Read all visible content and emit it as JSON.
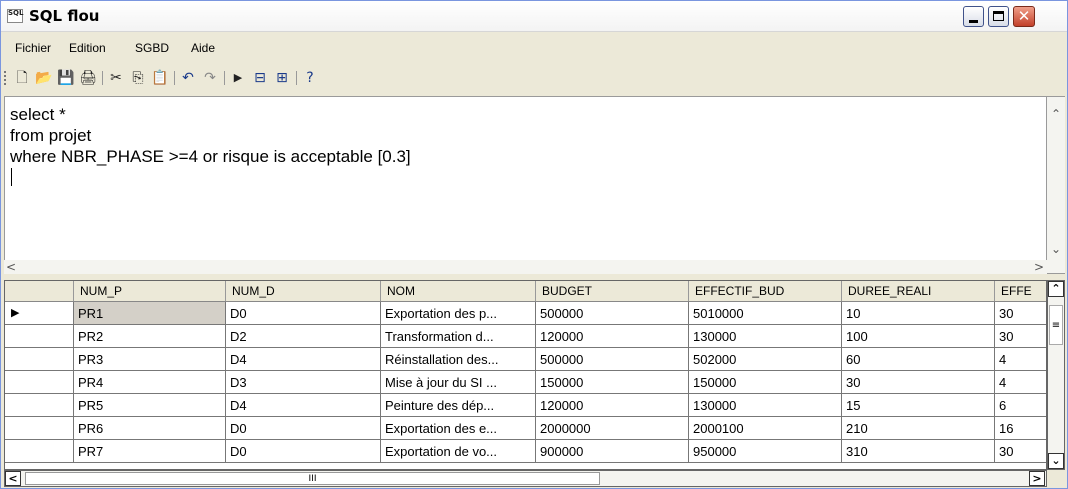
{
  "window": {
    "title": "SQL flou",
    "icon_text": "SQL",
    "icon": "sql-app-icon"
  },
  "menu": [
    "Fichier",
    "Edition",
    "SGBD",
    "Aide"
  ],
  "toolbar": {
    "icons": [
      "new-icon",
      "open-icon",
      "save-icon",
      "print-icon",
      "cut-icon",
      "copy-icon",
      "paste-icon",
      "undo-icon",
      "redo-icon",
      "run-icon",
      "import-icon",
      "export-icon",
      "help-icon"
    ]
  },
  "editor": {
    "lines": [
      "select *",
      "from projet",
      "where NBR_PHASE >=4 or risque is acceptable [0.3]"
    ]
  },
  "grid": {
    "columns": [
      "NUM_P",
      "NUM_D",
      "NOM",
      "BUDGET",
      "EFFECTIF_BUD",
      "DUREE_REALI",
      "EFFE"
    ],
    "rows": [
      [
        "PR1",
        "D0",
        "Exportation des p...",
        "500000",
        "5010000",
        "10",
        "30"
      ],
      [
        "PR2",
        "D2",
        "Transformation d...",
        "120000",
        "130000",
        "100",
        "30"
      ],
      [
        "PR3",
        "D4",
        "Réinstallation des...",
        "500000",
        "502000",
        "60",
        "4"
      ],
      [
        "PR4",
        "D3",
        "Mise à jour du SI ...",
        "150000",
        "150000",
        "30",
        "4"
      ],
      [
        "PR5",
        "D4",
        "Peinture des dép...",
        "120000",
        "130000",
        "15",
        "6"
      ],
      [
        "PR6",
        "D0",
        "Exportation des e...",
        "2000000",
        "2000100",
        "210",
        "16"
      ],
      [
        "PR7",
        "D0",
        "Exportation de vo...",
        "900000",
        "950000",
        "310",
        "30"
      ]
    ],
    "current_row_marker": "▶"
  },
  "scroll": {
    "thumb_glyph": "III",
    "vthumb_glyph": "≡"
  }
}
